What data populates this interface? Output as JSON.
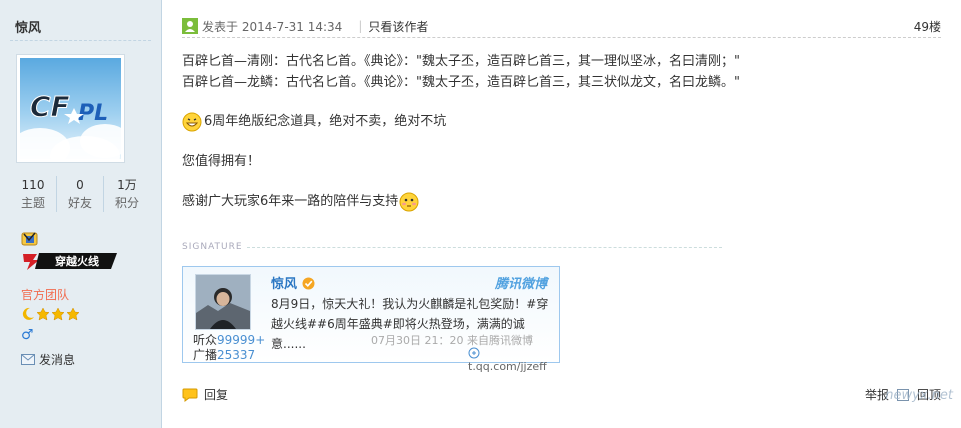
{
  "user": {
    "name": "惊风",
    "stats": [
      {
        "value": "110",
        "label": "主题"
      },
      {
        "value": "0",
        "label": "好友"
      },
      {
        "value": "1万",
        "label": "积分"
      }
    ],
    "badge_text": "穿越火线",
    "team": "官方团队",
    "gender_symbol": "♂",
    "message_label": "发消息"
  },
  "post": {
    "posted_label": "发表于 2014-7-31 14:34",
    "only_author": "只看该作者",
    "floor": "49楼",
    "lines": [
      "百辟匕首—清刚：古代名匕首。《典论》：\"魏太子丕，造百辟匕首三，其一理似坚冰，名曰清刚；\"",
      "百辟匕首—龙鳞：古代名匕首。《典论》：\"魏太子丕，造百辟匕首三，其三状似龙文，名曰龙鳞。\"",
      "6周年绝版纪念道具，绝对不卖，绝对不坑",
      "您值得拥有！",
      "感谢广大玩家6年来一路的陪伴与支持"
    ]
  },
  "signature": {
    "label": "SIGNATURE",
    "weibo": {
      "name": "惊风",
      "brand": "腾讯微博",
      "text_line1": "8月9日，惊天大礼！我认为火麒麟是礼包奖励！#穿",
      "text_line2": "越火线##6周年盛典#即将火热登场，满满的诚意......",
      "time": "07月30日  21：20 来自腾讯微博",
      "link": "t.qq.com/jjzeff",
      "fans_label": "听众",
      "fans_value": "99999+",
      "posts_label": "广播",
      "posts_value": "25337"
    }
  },
  "footer": {
    "reply": "回复",
    "report": "举报",
    "top": "回顶"
  },
  "watermark": "newyx.net"
}
